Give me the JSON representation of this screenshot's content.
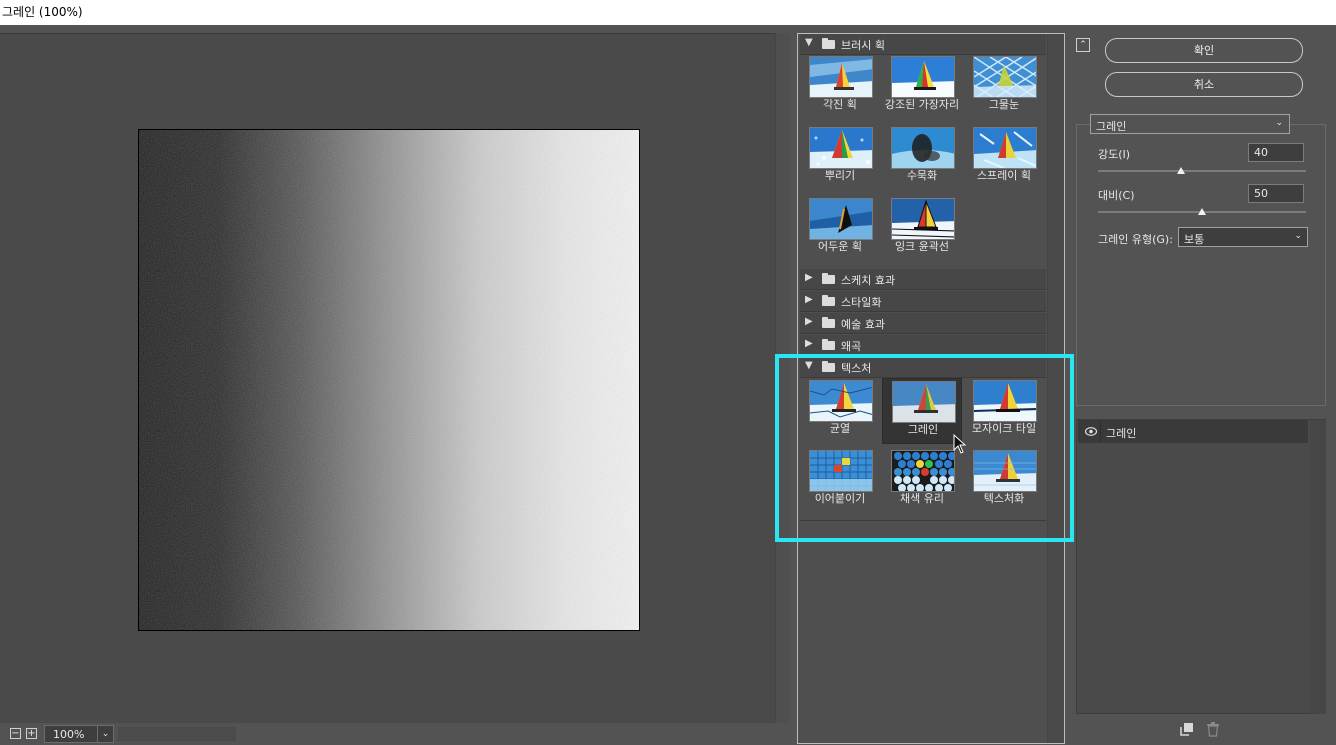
{
  "window": {
    "title": "그레인 (100%)"
  },
  "zoom": {
    "value": "100%",
    "minus": "−",
    "plus": "+",
    "arrow": "⌄"
  },
  "gallery": {
    "categories": [
      {
        "label": "브러시 획",
        "expanded": true,
        "items": [
          {
            "label": "각진 획"
          },
          {
            "label": "강조된 가장자리"
          },
          {
            "label": "그물눈"
          },
          {
            "label": "뿌리기"
          },
          {
            "label": "수묵화"
          },
          {
            "label": "스프레이 획"
          },
          {
            "label": "어두운 획"
          },
          {
            "label": "잉크 윤곽선"
          }
        ]
      },
      {
        "label": "스케치 효과",
        "expanded": false
      },
      {
        "label": "스타일화",
        "expanded": false
      },
      {
        "label": "예술 효과",
        "expanded": false
      },
      {
        "label": "왜곡",
        "expanded": false
      },
      {
        "label": "텍스처",
        "expanded": true,
        "items": [
          {
            "label": "균열"
          },
          {
            "label": "그레인",
            "selected": true
          },
          {
            "label": "모자이크 타일"
          },
          {
            "label": "이어붙이기"
          },
          {
            "label": "채색 유리"
          },
          {
            "label": "텍스처화"
          }
        ]
      }
    ],
    "highlight_color": "#29e6f0"
  },
  "buttons": {
    "ok": "확인",
    "cancel": "취소",
    "collapse": "⌃"
  },
  "settings": {
    "filter": "그레인",
    "intensity": {
      "label": "강도(I)",
      "value": "40",
      "fraction": 0.4
    },
    "contrast": {
      "label": "대비(C)",
      "value": "50",
      "fraction": 0.5
    },
    "grain_type": {
      "label": "그레인 유형(G):",
      "value": "보통"
    }
  },
  "layers": {
    "items": [
      {
        "name": "그레인"
      }
    ]
  }
}
